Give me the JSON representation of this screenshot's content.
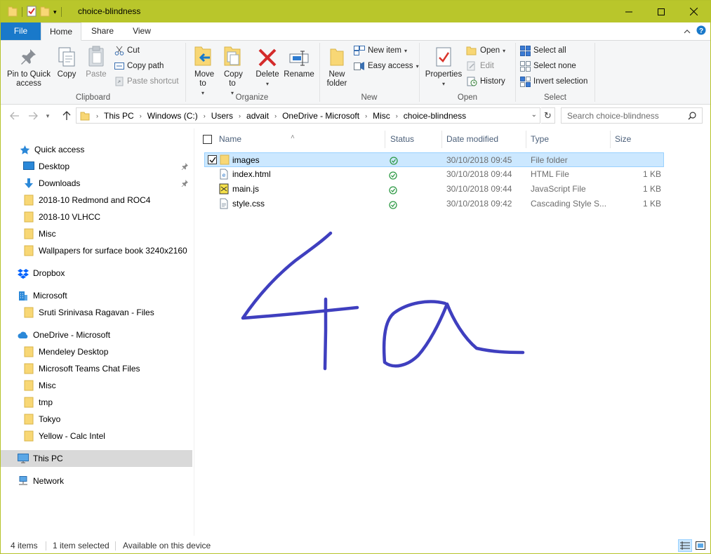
{
  "window": {
    "title": "choice-blindness",
    "controls": [
      "minimize",
      "maximize",
      "close"
    ],
    "titlebar_color": "#b9c62b",
    "accent": "#1979ca"
  },
  "ribbon": {
    "tabs": [
      {
        "label": "File"
      },
      {
        "label": "Home"
      },
      {
        "label": "Share"
      },
      {
        "label": "View"
      }
    ],
    "active_tab": "Home",
    "clipboard": {
      "label": "Clipboard",
      "pin": "Pin to Quick access",
      "copy": "Copy",
      "paste": "Paste",
      "cut": "Cut",
      "copy_path": "Copy path",
      "paste_shortcut": "Paste shortcut"
    },
    "organize": {
      "label": "Organize",
      "move_to": "Move to",
      "copy_to": "Copy to",
      "delete": "Delete",
      "rename": "Rename"
    },
    "new": {
      "label": "New",
      "new_folder": "New folder",
      "new_item": "New item",
      "easy_access": "Easy access"
    },
    "open": {
      "label": "Open",
      "properties": "Properties",
      "open": "Open",
      "edit": "Edit",
      "history": "History"
    },
    "select": {
      "label": "Select",
      "select_all": "Select all",
      "select_none": "Select none",
      "invert_selection": "Invert selection"
    }
  },
  "address": {
    "crumbs": [
      "This PC",
      "Windows (C:)",
      "Users",
      "advait",
      "OneDrive - Microsoft",
      "Misc",
      "choice-blindness"
    ],
    "search_placeholder": "Search choice-blindness"
  },
  "nav_pane": {
    "quick_access": "Quick access",
    "quick_items": [
      {
        "label": "Desktop",
        "icon": "desktop-icon",
        "pinned": true
      },
      {
        "label": "Downloads",
        "icon": "downloads-icon",
        "pinned": true
      },
      {
        "label": "2018-10 Redmond and ROC4",
        "icon": "folder-icon"
      },
      {
        "label": "2018-10 VLHCC",
        "icon": "folder-icon"
      },
      {
        "label": "Misc",
        "icon": "folder-icon"
      },
      {
        "label": "Wallpapers for surface book 3240x2160",
        "icon": "folder-icon"
      }
    ],
    "dropbox": "Dropbox",
    "microsoft": "Microsoft",
    "microsoft_items": [
      {
        "label": "Sruti Srinivasa Ragavan - Files"
      }
    ],
    "onedrive": "OneDrive - Microsoft",
    "onedrive_items": [
      {
        "label": "Mendeley Desktop"
      },
      {
        "label": "Microsoft Teams Chat Files"
      },
      {
        "label": "Misc"
      },
      {
        "label": "tmp"
      },
      {
        "label": "Tokyo"
      },
      {
        "label": "Yellow - Calc Intel"
      }
    ],
    "this_pc": "This PC",
    "network": "Network"
  },
  "file_list": {
    "columns": [
      "Name",
      "Status",
      "Date modified",
      "Type",
      "Size"
    ],
    "rows": [
      {
        "name": "images",
        "icon": "folder-icon",
        "status": "synced",
        "date": "30/10/2018 09:45",
        "type": "File folder",
        "size": "",
        "selected": true
      },
      {
        "name": "index.html",
        "icon": "html-file-icon",
        "status": "synced",
        "date": "30/10/2018 09:44",
        "type": "HTML File",
        "size": "1 KB",
        "selected": false
      },
      {
        "name": "main.js",
        "icon": "js-file-icon",
        "status": "synced",
        "date": "30/10/2018 09:44",
        "type": "JavaScript File",
        "size": "1 KB",
        "selected": false
      },
      {
        "name": "style.css",
        "icon": "css-file-icon",
        "status": "synced",
        "date": "30/10/2018 09:42",
        "type": "Cascading Style S...",
        "size": "1 KB",
        "selected": false
      }
    ]
  },
  "ink": {
    "color": "#3f3fbf",
    "text": "4a"
  },
  "status_bar": {
    "item_count": "4 items",
    "selection": "1 item selected",
    "availability": "Available on this device"
  }
}
